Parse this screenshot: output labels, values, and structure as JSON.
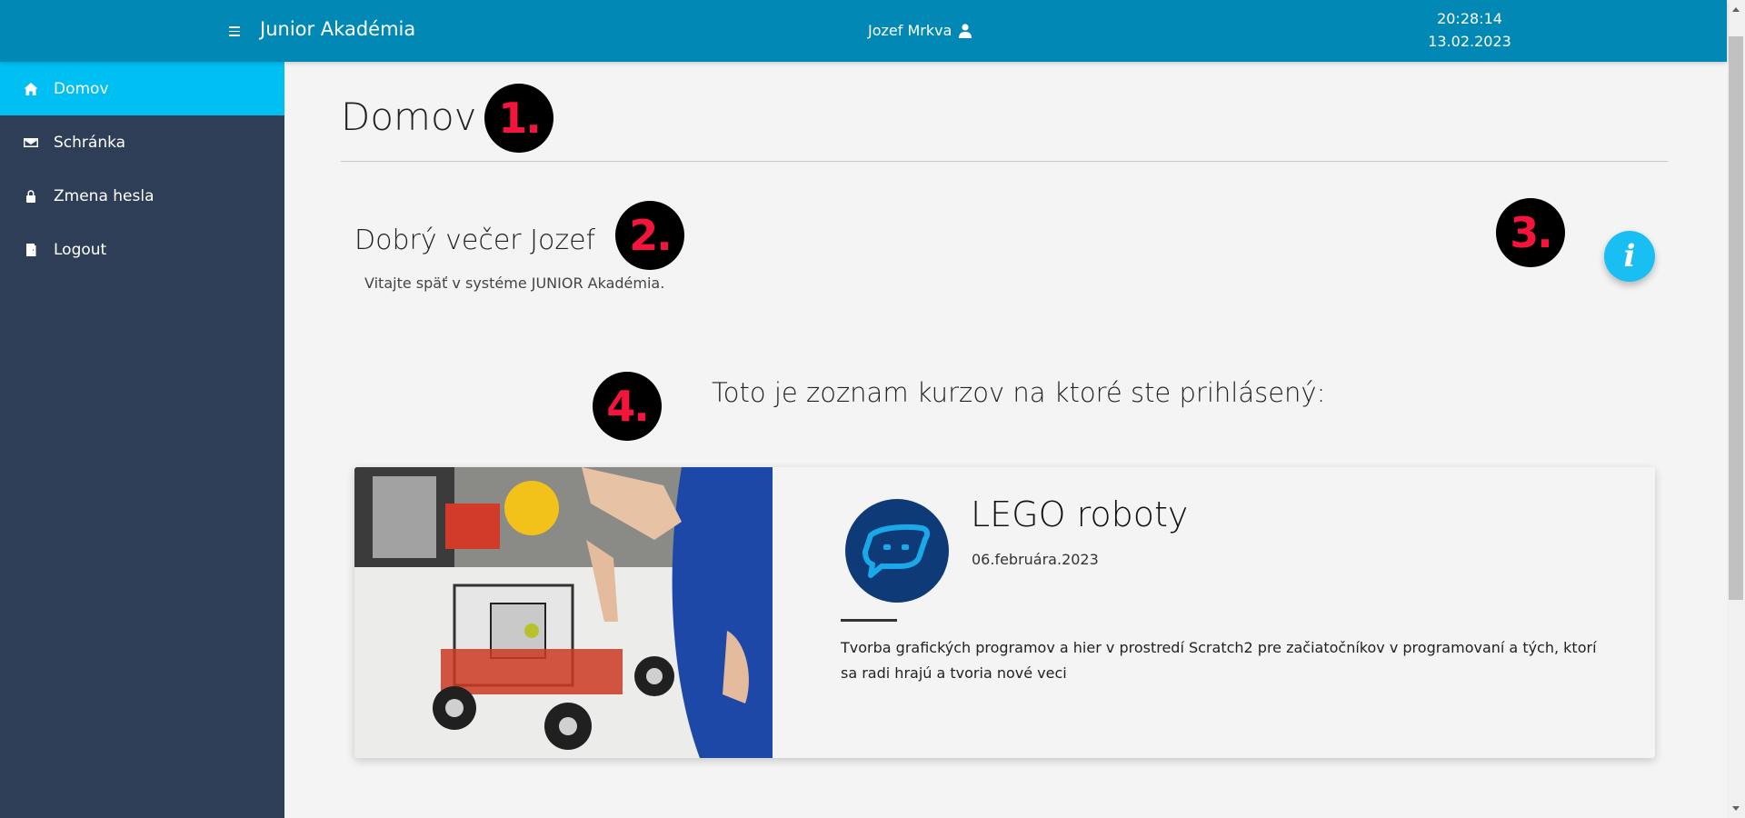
{
  "app": {
    "title": "Junior Akadémia",
    "user_name": "Jozef Mrkva",
    "time": "20:28:14",
    "date": "13.02.2023"
  },
  "sidebar": {
    "items": [
      {
        "label": "Domov",
        "icon": "home-icon",
        "active": true
      },
      {
        "label": "Schránka",
        "icon": "envelope-icon",
        "active": false
      },
      {
        "label": "Zmena hesla",
        "icon": "lock-icon",
        "active": false
      },
      {
        "label": "Logout",
        "icon": "door-icon",
        "active": false
      }
    ]
  },
  "main": {
    "page_title": "Domov",
    "greeting": "Dobrý večer Jozef",
    "welcome_text": "Vitajte späť v systéme JUNIOR Akadémia.",
    "info_button": "i",
    "courses_heading": "Toto je zoznam kurzov na ktoré ste prihlásený:",
    "courses": [
      {
        "name": "LEGO roboty",
        "date": "06.februára.2023",
        "description": "Tvorba grafických programov a hier v prostredí Scratch2 pre začiatočníkov v programovaní a tých, ktorí sa radi hrajú a tvoria nové veci"
      }
    ]
  },
  "annotations": {
    "markers": [
      "1.",
      "2.",
      "3.",
      "4."
    ]
  },
  "colors": {
    "topbar": "#0288b4",
    "sidebar": "#2d3e56",
    "active_item": "#00bff3",
    "info_button": "#19bff2",
    "marker_text": "#f5143c"
  }
}
